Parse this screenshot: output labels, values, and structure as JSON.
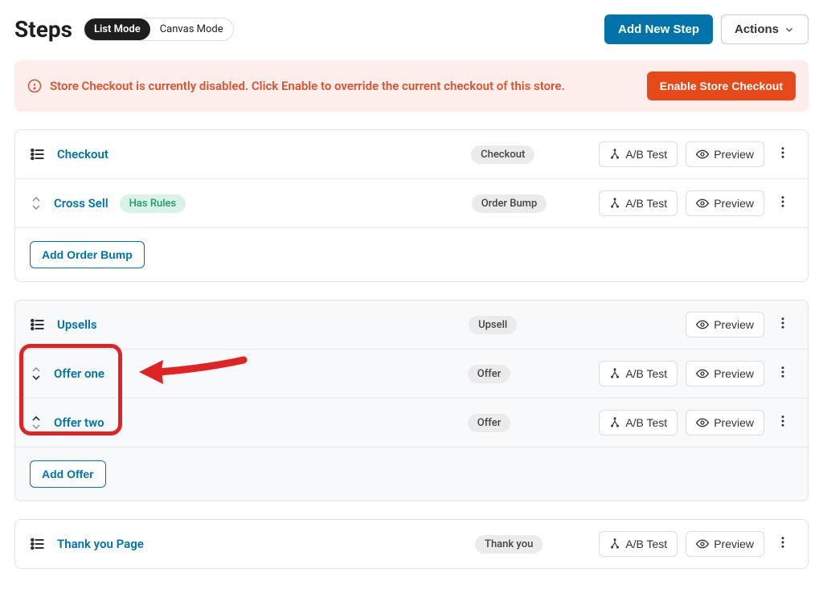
{
  "header": {
    "title": "Steps",
    "mode_list": "List Mode",
    "mode_canvas": "Canvas Mode",
    "add_step": "Add New Step",
    "actions": "Actions"
  },
  "alert": {
    "text": "Store Checkout is currently disabled. Click Enable to override the current checkout of this store.",
    "button": "Enable Store Checkout"
  },
  "labels": {
    "ab_test": "A/B Test",
    "preview": "Preview",
    "add_order_bump": "Add Order Bump",
    "add_offer": "Add Offer",
    "has_rules": "Has Rules"
  },
  "panel1": {
    "rows": [
      {
        "name": "Checkout",
        "badge": "Checkout",
        "has_rules": false,
        "reorder": false,
        "ab": true
      },
      {
        "name": "Cross Sell",
        "badge": "Order Bump",
        "has_rules": true,
        "reorder": true,
        "ab": true
      }
    ]
  },
  "panel2": {
    "header": {
      "name": "Upsells",
      "badge": "Upsell"
    },
    "rows": [
      {
        "name": "Offer one",
        "badge": "Offer",
        "ab": true
      },
      {
        "name": "Offer two",
        "badge": "Offer",
        "ab": true
      }
    ]
  },
  "panel3": {
    "rows": [
      {
        "name": "Thank you Page",
        "badge": "Thank you",
        "ab": true
      }
    ]
  },
  "annotation": {
    "type": "highlight-with-arrow",
    "target": "offer-rows",
    "color": "#e02424"
  }
}
